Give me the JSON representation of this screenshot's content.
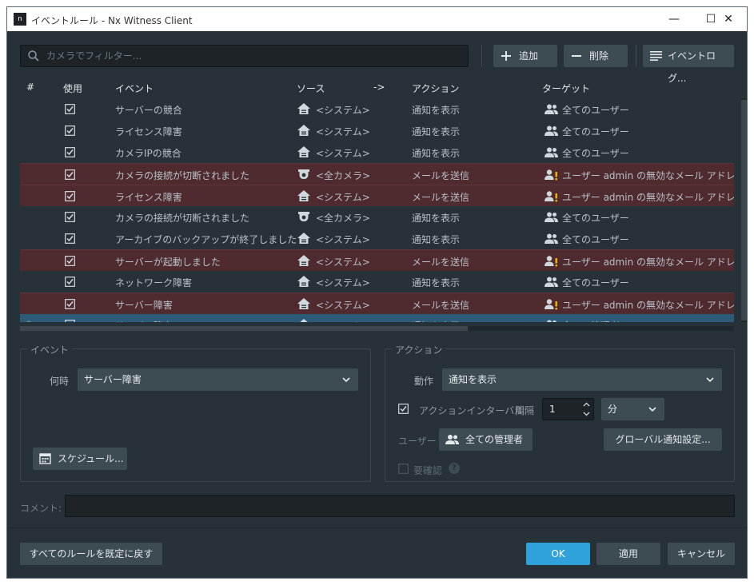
{
  "window": {
    "title": "イベントルール - Nx Witness Client",
    "icon_text": "n",
    "controls": {
      "minimize": "—",
      "maximize": "☐",
      "close": "✕"
    }
  },
  "toolbar": {
    "search_placeholder": "カメラでフィルター...",
    "add_label": "追加",
    "delete_label": "削除",
    "event_log_label": "イベントログ..."
  },
  "table": {
    "columns": [
      "#",
      "使用",
      "イベント",
      "ソース",
      "->",
      "アクション",
      "ターゲット"
    ],
    "rows": [
      {
        "number": "",
        "enabled": true,
        "event": "サーバーの競合",
        "source_icon": "server-icon",
        "source": "<システム>",
        "action": "通知を表示",
        "target_icon": "users-icon",
        "target": "全てのユーザー",
        "state": "normal"
      },
      {
        "number": "",
        "enabled": true,
        "event": "ライセンス障害",
        "source_icon": "server-icon",
        "source": "<システム>",
        "action": "通知を表示",
        "target_icon": "users-icon",
        "target": "全てのユーザー",
        "state": "normal"
      },
      {
        "number": "",
        "enabled": true,
        "event": "カメラIPの競合",
        "source_icon": "server-icon",
        "source": "<システム>",
        "action": "通知を表示",
        "target_icon": "users-icon",
        "target": "全てのユーザー",
        "state": "normal"
      },
      {
        "number": "",
        "enabled": true,
        "event": "カメラの接続が切断されました",
        "source_icon": "camera-icon",
        "source": "<全カメラ>",
        "action": "メールを送信",
        "target_icon": "user-warning-icon",
        "target": "ユーザー admin の無効なメール アドレス",
        "state": "warning"
      },
      {
        "number": "",
        "enabled": true,
        "event": "ライセンス障害",
        "source_icon": "server-icon",
        "source": "<システム>",
        "action": "メールを送信",
        "target_icon": "user-warning-icon",
        "target": "ユーザー admin の無効なメール アドレス",
        "state": "warning"
      },
      {
        "number": "",
        "enabled": true,
        "event": "カメラの接続が切断されました",
        "source_icon": "camera-icon",
        "source": "<全カメラ>",
        "action": "通知を表示",
        "target_icon": "users-icon",
        "target": "全てのユーザー",
        "state": "normal"
      },
      {
        "number": "",
        "enabled": true,
        "event": "アーカイブのバックアップが終了しました",
        "source_icon": "server-icon",
        "source": "<システム>",
        "action": "通知を表示",
        "target_icon": "users-icon",
        "target": "全てのユーザー",
        "state": "normal"
      },
      {
        "number": "",
        "enabled": true,
        "event": "サーバーが起動しました",
        "source_icon": "server-icon",
        "source": "<システム>",
        "action": "メールを送信",
        "target_icon": "user-warning-icon",
        "target": "ユーザー admin の無効なメール アドレス",
        "state": "warning"
      },
      {
        "number": "",
        "enabled": true,
        "event": "ネットワーク障害",
        "source_icon": "server-icon",
        "source": "<システム>",
        "action": "通知を表示",
        "target_icon": "users-icon",
        "target": "全てのユーザー",
        "state": "normal"
      },
      {
        "number": "",
        "enabled": true,
        "event": "サーバー障害",
        "source_icon": "server-icon",
        "source": "<システム>",
        "action": "メールを送信",
        "target_icon": "user-warning-icon",
        "target": "ユーザー admin の無効なメール アドレス",
        "state": "warning"
      },
      {
        "number": "*",
        "enabled": true,
        "event": "サーバー障害",
        "source_icon": "server-icon",
        "source": "<システム>",
        "action": "通知を表示",
        "target_icon": "users-icon",
        "target": "全ての管理者",
        "state": "selected"
      }
    ]
  },
  "event_panel": {
    "title": "イベント",
    "when_label": "何時",
    "when_value": "サーバー障害",
    "schedule_label": "スケジュール..."
  },
  "action_panel": {
    "title": "アクション",
    "action_label": "動作",
    "action_value": "通知を表示",
    "interval_checked": true,
    "interval_label": "アクションインターバル:",
    "interval_sub_label": "間隔",
    "interval_value": "1",
    "interval_unit": "分",
    "users_label": "ユーザー",
    "users_value": "全ての管理者",
    "global_settings_label": "グローバル通知設定...",
    "ack_checked": false,
    "ack_label": "要確認",
    "help_glyph": "?"
  },
  "comment": {
    "label": "コメント:",
    "value": ""
  },
  "footer": {
    "reset_label": "すべてのルールを既定に戻す",
    "ok_label": "OK",
    "apply_label": "適用",
    "cancel_label": "キャンセル"
  },
  "colors": {
    "background": "#263238",
    "warning_row": "#4f2a2f",
    "selected_row": "#2b5b78",
    "primary_button": "#2fa2db",
    "warning_icon": "#f5b700"
  }
}
